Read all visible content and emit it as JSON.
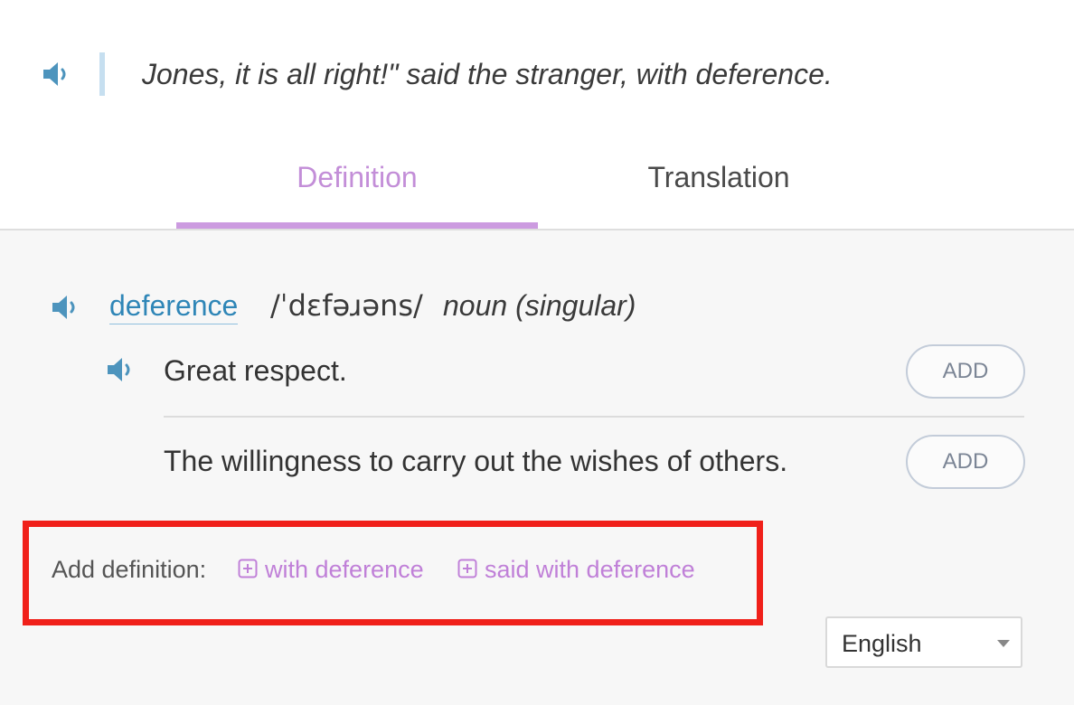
{
  "sentence": {
    "text": "Jones, it is all right!\" said the stranger, with deference.",
    "speaker_icon": "speaker-icon"
  },
  "tabs": [
    {
      "label": "Definition",
      "active": true
    },
    {
      "label": "Translation",
      "active": false
    }
  ],
  "entry": {
    "word": "deference",
    "phonetic": "/ˈdɛfəɹəns/",
    "part_of_speech": "noun (singular)",
    "definitions": [
      {
        "text": "Great respect.",
        "has_audio": true,
        "button_label": "ADD"
      },
      {
        "text": "The willingness to carry out the wishes of others.",
        "has_audio": false,
        "button_label": "ADD"
      }
    ]
  },
  "add_definition": {
    "label": "Add definition:",
    "links": [
      {
        "text": "with deference",
        "icon": "plus-square-icon"
      },
      {
        "text": "said with deference",
        "icon": "plus-square-icon"
      }
    ]
  },
  "language": {
    "selected": "English"
  },
  "colors": {
    "accent_purple": "#c38ed8",
    "link_blue": "#2f86b7",
    "speaker_blue": "#4d94bd",
    "highlight_red": "#f0201a"
  }
}
